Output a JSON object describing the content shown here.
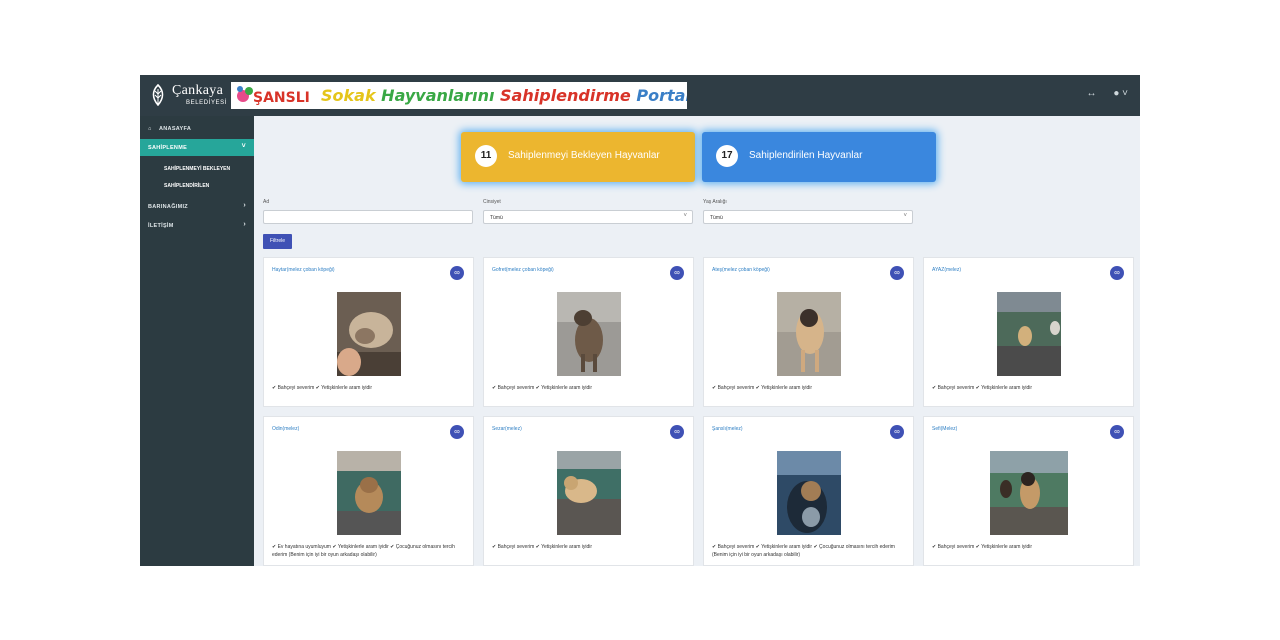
{
  "brand": {
    "name": "Çankaya",
    "sub": "BELEDİYESİ",
    "banner_badge": "ŞANSLI",
    "banner_words": [
      "Sokak",
      "Hayvanlarını",
      "Sahiplendirme",
      "Portalı"
    ]
  },
  "topbar": {
    "toggle_icon": "arrows-icon",
    "user_icon": "user-icon"
  },
  "sidebar": {
    "items": [
      {
        "label": "ANASAYFA",
        "icon": "home-icon"
      },
      {
        "label": "SAHİPLENME"
      },
      {
        "label": "SAHİPLENMEYİ BEKLEYEN"
      },
      {
        "label": "SAHİPLENDİRİLEN"
      },
      {
        "label": "BARINAĞIMIZ"
      },
      {
        "label": "İLETİŞİM"
      }
    ]
  },
  "stats": [
    {
      "count": "11",
      "label": "Sahiplenmeyi Bekleyen Hayvanlar",
      "color": "#ecb62f"
    },
    {
      "count": "17",
      "label": "Sahiplendirilen Hayvanlar",
      "color": "#3a87de"
    }
  ],
  "filters": {
    "name_label": "Ad",
    "name_value": "",
    "gender_label": "Cinsiyet",
    "gender_value": "Tümü",
    "age_label": "Yaş Aralığı",
    "age_value": "Tümü",
    "button": "Filtrele"
  },
  "cards": [
    {
      "title": "Haytar(melez çoban köpeği)",
      "tags": "✔ Bahçeyi severim ✔ Yetişkinlerle aram iyidir"
    },
    {
      "title": "Gofret(melez çoban köpeği)",
      "tags": "✔ Bahçeyi severim ✔ Yetişkinlerle aram iyidir"
    },
    {
      "title": "Ateş(melez çoban köpeği)",
      "tags": "✔ Bahçeyi severim ✔ Yetişkinlerle aram iyidir"
    },
    {
      "title": "AYAZ(melez)",
      "tags": "✔ Bahçeyi severim ✔ Yetişkinlerle aram iyidir"
    },
    {
      "title": "Odin(melez)",
      "tags": "✔ Ev hayatına uyumluyum ✔ Yetişkinlerle aram iyidir ✔ Çocuğunuz olmasını tercih ederim (Benim için iyi bir oyun arkadaşı olabilir)"
    },
    {
      "title": "Sezar(melez)",
      "tags": "✔ Bahçeyi severim ✔ Yetişkinlerle aram iyidir"
    },
    {
      "title": "Şanslı(melez)",
      "tags": "✔ Bahçeyi severim ✔ Yetişkinlerle aram iyidir ✔ Çocuğunuz olmasını tercih ederim (Benim için iyi bir oyun arkadaşı olabilir)"
    },
    {
      "title": "Sefi(Melez)",
      "tags": "✔ Bahçeyi severim ✔ Yetişkinlerle aram iyidir"
    }
  ]
}
